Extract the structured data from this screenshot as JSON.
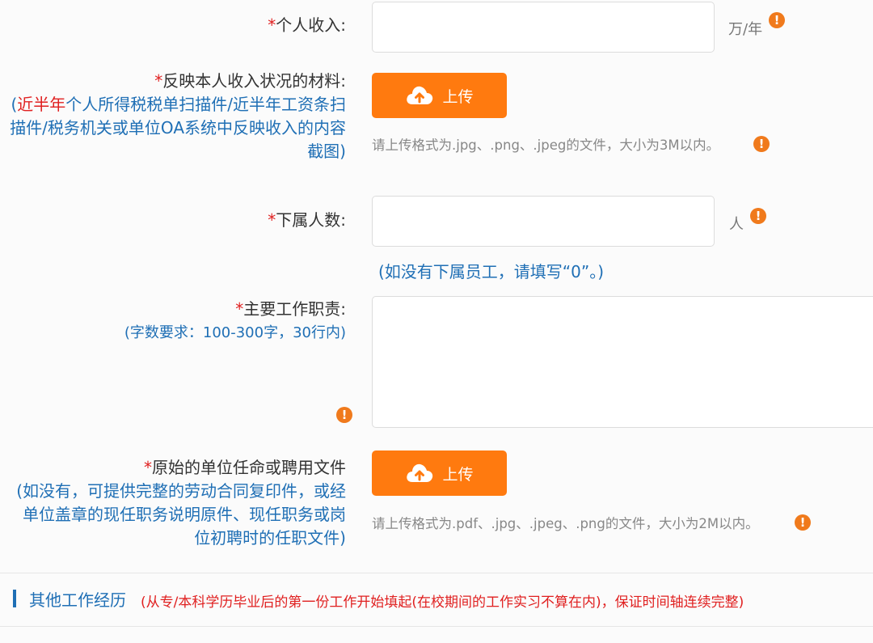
{
  "income": {
    "asterisk": "*",
    "label": "个人收入:",
    "unit": "万/年"
  },
  "income_material": {
    "asterisk": "*",
    "label": "反映本人收入状况的材料:",
    "note_open": "(",
    "note_red": "近半年",
    "note_line1_rest": "个人所得税税单扫描件/近半年工资条扫",
    "note_line2": "描件/税务机关或单位OA系统中反映收入的内容",
    "note_line3": "截图)",
    "upload_label": "上传",
    "hint": "请上传格式为.jpg、.png、.jpeg的文件，大小为3M以内。"
  },
  "subordinates": {
    "asterisk": "*",
    "label": "下属人数:",
    "unit": "人",
    "note": "(如没有下属员工，请填写“0”。)"
  },
  "duties": {
    "asterisk": "*",
    "label": "主要工作职责:",
    "note": "(字数要求：100-300字，30行内)"
  },
  "appointment": {
    "asterisk": "*",
    "label": "原始的单位任命或聘用文件",
    "note_line1": "(如没有，可提供完整的劳动合同复印件，或经",
    "note_line2": "单位盖章的现任职务说明原件、现任职务或岗",
    "note_line3": "位初聘时的任职文件)",
    "upload_label": "上传",
    "hint": "请上传格式为.pdf、.jpg、.jpeg、.png的文件，大小为2M以内。"
  },
  "section": {
    "title": "其他工作经历",
    "note": "(从专/本科学历毕业后的第一份工作开始填起(在校期间的工作实习不算在内)，保证时间轴连续完整)"
  },
  "warn_glyph": "!",
  "colors": {
    "accent_orange": "#ff7a0f",
    "warn_orange": "#f07a1c",
    "required_red": "#e02020",
    "note_blue": "#1f6fb5"
  }
}
